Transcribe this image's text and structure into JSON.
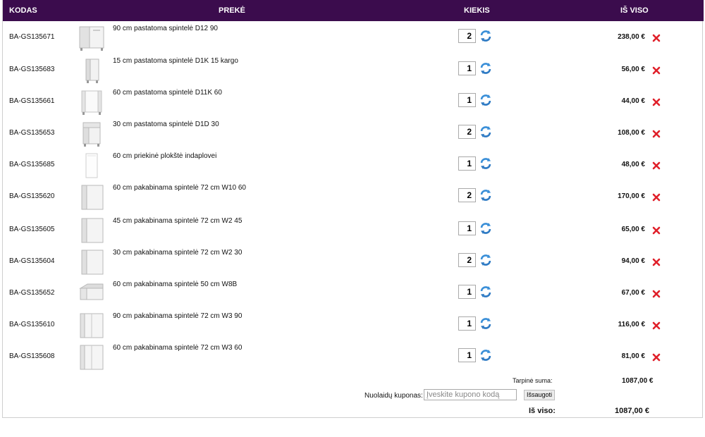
{
  "header": {
    "code": "KODAS",
    "product": "PREKĖ",
    "qty": "KIEKIS",
    "total": "IŠ VISO"
  },
  "items": [
    {
      "code": "BA-GS135671",
      "name": "90 cm pastatoma spintelė D12 90",
      "qty": "2",
      "price": "238,00 €",
      "thumb": "corner-base-cabinet"
    },
    {
      "code": "BA-GS135683",
      "name": "15 cm pastatoma spintelė D1K 15 kargo",
      "qty": "1",
      "price": "56,00 €",
      "thumb": "narrow-cargo-cabinet"
    },
    {
      "code": "BA-GS135661",
      "name": "60 cm pastatoma spintelė D11K 60",
      "qty": "1",
      "price": "44,00 €",
      "thumb": "open-base-cabinet"
    },
    {
      "code": "BA-GS135653",
      "name": "30 cm pastatoma spintelė D1D 30",
      "qty": "2",
      "price": "108,00 €",
      "thumb": "base-cabinet-with-drawer"
    },
    {
      "code": "BA-GS135685",
      "name": "60 cm priekinė plokštė indaplovei",
      "qty": "1",
      "price": "48,00 €",
      "thumb": "front-panel"
    },
    {
      "code": "BA-GS135620",
      "name": "60 cm pakabinama spintelė 72 cm W10 60",
      "qty": "2",
      "price": "170,00 €",
      "thumb": "wall-cabinet"
    },
    {
      "code": "BA-GS135605",
      "name": "45 cm pakabinama spintelė 72 cm W2 45",
      "qty": "1",
      "price": "65,00 €",
      "thumb": "wall-cabinet"
    },
    {
      "code": "BA-GS135604",
      "name": "30 cm pakabinama spintelė 72 cm W2 30",
      "qty": "2",
      "price": "94,00 €",
      "thumb": "wall-cabinet"
    },
    {
      "code": "BA-GS135652",
      "name": "60 cm pakabinama spintelė 50 cm W8B",
      "qty": "1",
      "price": "67,00 €",
      "thumb": "flip-up-wall-cabinet"
    },
    {
      "code": "BA-GS135610",
      "name": "90 cm pakabinama spintelė 72 cm W3 90",
      "qty": "1",
      "price": "116,00 €",
      "thumb": "double-wall-cabinet"
    },
    {
      "code": "BA-GS135608",
      "name": "60 cm pakabinama spintelė 72 cm W3 60",
      "qty": "1",
      "price": "81,00 €",
      "thumb": "double-wall-cabinet"
    }
  ],
  "summary": {
    "subtotal_label": "Tarpinė suma:",
    "subtotal_value": "1087,00 €",
    "coupon_label": "Nuolaidų kuponas:",
    "coupon_placeholder": "Įveskite kupono kodą",
    "save_label": "Išsaugoti",
    "total_label": "Iš viso:",
    "total_value": "1087,00 €"
  },
  "colors": {
    "header_bg": "#3b0c4d",
    "remove": "#e0202a",
    "refresh": "#3a8fd8"
  }
}
